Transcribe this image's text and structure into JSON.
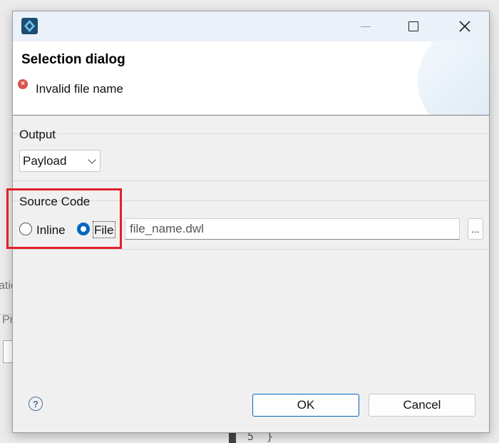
{
  "background": {
    "fragment_1": "atic",
    "fragment_2": "Pr",
    "line_number": "5",
    "code_char": "}"
  },
  "dialog": {
    "title": "Selection dialog",
    "error_message": "Invalid file name"
  },
  "output": {
    "label": "Output",
    "selected": "Payload"
  },
  "source_code": {
    "label": "Source Code",
    "inline_label": "Inline",
    "file_label": "File",
    "selected": "File",
    "file_value": "file_name.dwl",
    "browse_label": "..."
  },
  "buttons": {
    "help": "?",
    "ok": "OK",
    "cancel": "Cancel"
  },
  "colors": {
    "accent": "#0067c0",
    "error": "#d9534f",
    "highlight": "#e4202c"
  }
}
